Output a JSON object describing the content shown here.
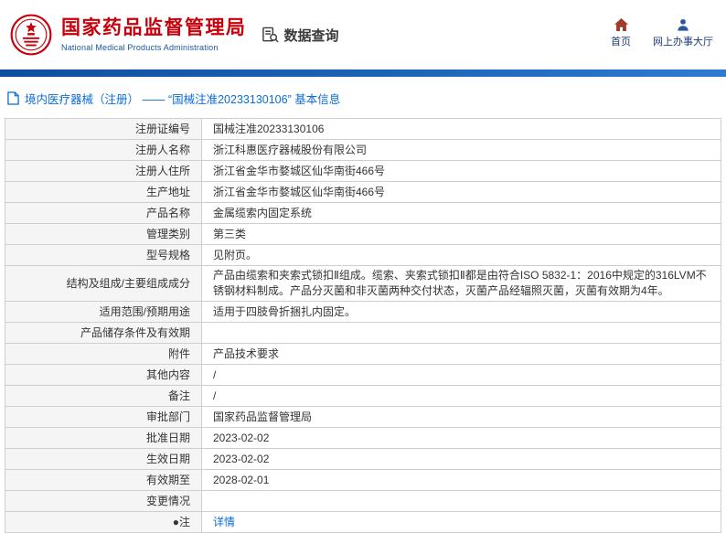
{
  "header": {
    "agency_cn": "国家药品监督管理局",
    "agency_en": "National Medical Products Administration",
    "section_title": "数据查询",
    "nav": [
      {
        "label": "首页",
        "icon": "home-icon"
      },
      {
        "label": "网上办事大厅",
        "icon": "person-icon"
      }
    ]
  },
  "colors": {
    "brand_red": "#c7000b",
    "brand_blue": "#1757a5",
    "bar_blue": "#1c64b8",
    "link_blue": "#0a6cd6",
    "label_cell_bg": "#f5f5f5"
  },
  "breadcrumb": {
    "text": "境内医疗器械（注册） —— “国械注准20233130106” 基本信息"
  },
  "table": {
    "rows": [
      {
        "label": "注册证编号",
        "value": "国械注准20233130106"
      },
      {
        "label": "注册人名称",
        "value": "浙江科惠医疗器械股份有限公司"
      },
      {
        "label": "注册人住所",
        "value": "浙江省金华市婺城区仙华南街466号"
      },
      {
        "label": "生产地址",
        "value": "浙江省金华市婺城区仙华南街466号"
      },
      {
        "label": "产品名称",
        "value": "金属缆索内固定系统"
      },
      {
        "label": "管理类别",
        "value": "第三类"
      },
      {
        "label": "型号规格",
        "value": "见附页。"
      },
      {
        "label": "结构及组成/主要组成成分",
        "value": "产品由缆索和夹索式锁扣Ⅱ组成。缆索、夹索式锁扣Ⅱ都是由符合ISO 5832-1：2016中规定的316LVM不锈钢材料制成。产品分灭菌和非灭菌两种交付状态，灭菌产品经辐照灭菌，灭菌有效期为4年。"
      },
      {
        "label": "适用范围/预期用途",
        "value": "适用于四肢骨折捆扎内固定。"
      },
      {
        "label": "产品储存条件及有效期",
        "value": ""
      },
      {
        "label": "附件",
        "value": "产品技术要求"
      },
      {
        "label": "其他内容",
        "value": "/"
      },
      {
        "label": "备注",
        "value": "/"
      },
      {
        "label": "审批部门",
        "value": "国家药品监督管理局"
      },
      {
        "label": "批准日期",
        "value": "2023-02-02"
      },
      {
        "label": "生效日期",
        "value": "2023-02-02"
      },
      {
        "label": "有效期至",
        "value": "2028-02-01"
      },
      {
        "label": "变更情况",
        "value": ""
      },
      {
        "label": "●注",
        "value": "详情",
        "link": true
      }
    ]
  }
}
